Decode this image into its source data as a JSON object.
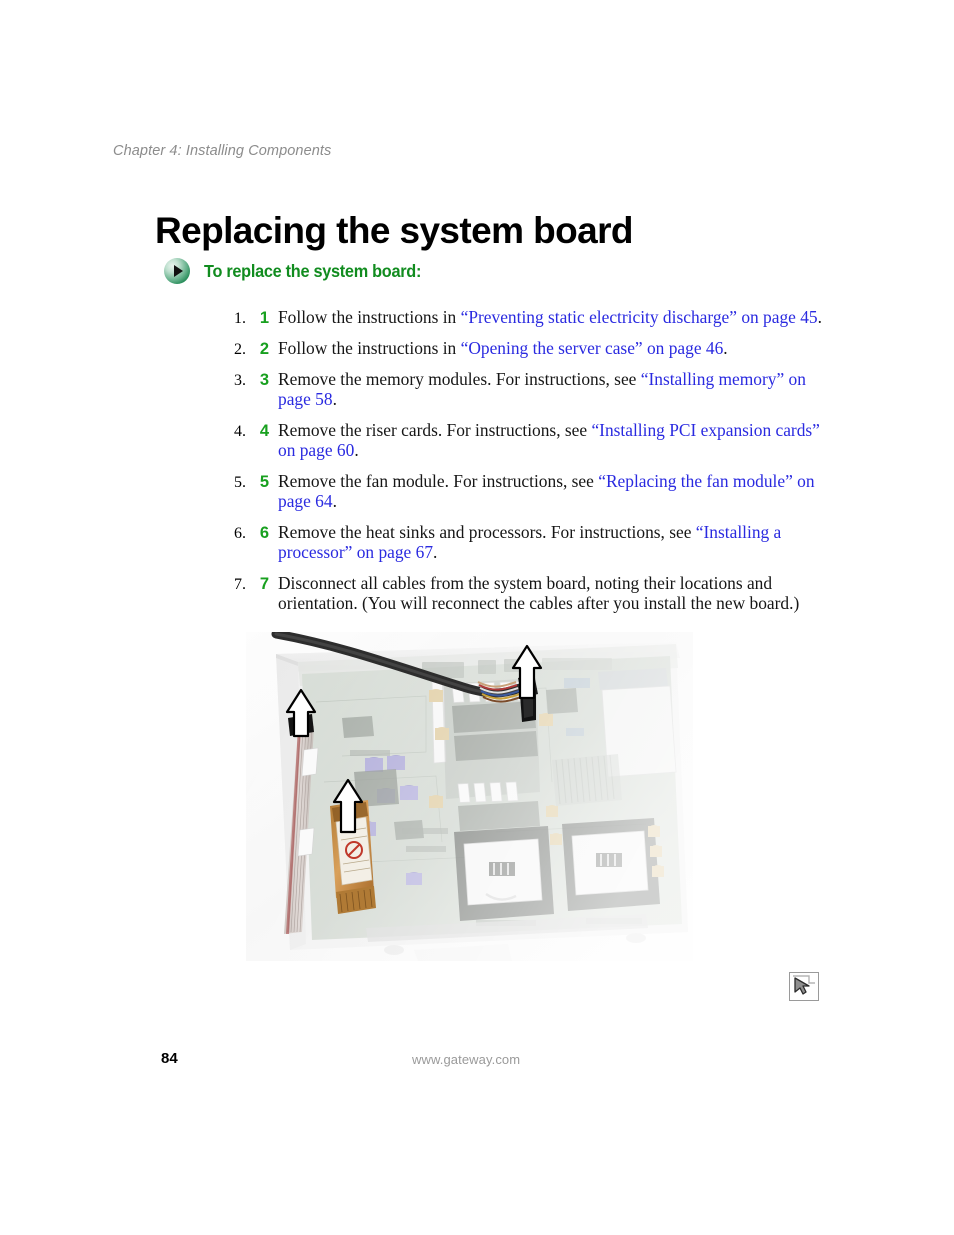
{
  "document": {
    "chapter_header": "Chapter 4: Installing Components",
    "page_title": "Replacing the system board",
    "page_number": "84",
    "footer_url": "www.gateway.com"
  },
  "procedure": {
    "bullet_icon": "play-triangle-icon",
    "heading": "To replace the system board:",
    "heading_color": "#118c1f",
    "number_color": "#18a01f",
    "xref_color": "#2a2ae0",
    "steps": [
      {
        "number": "1",
        "parts": [
          {
            "text": "Follow the instructions in ",
            "style": "normal"
          },
          {
            "text": "“Preventing static electricity discharge” on page 45",
            "style": "xref"
          },
          {
            "text": ".",
            "style": "normal"
          }
        ]
      },
      {
        "number": "2",
        "parts": [
          {
            "text": "Follow the instructions in ",
            "style": "normal"
          },
          {
            "text": "“Opening the server case” on page 46",
            "style": "xref"
          },
          {
            "text": ".",
            "style": "normal"
          }
        ]
      },
      {
        "number": "3",
        "parts": [
          {
            "text": "Remove the memory modules. For instructions, see ",
            "style": "normal"
          },
          {
            "text": "“Installing memory” on page 58",
            "style": "xref"
          },
          {
            "text": ".",
            "style": "normal"
          }
        ]
      },
      {
        "number": "4",
        "parts": [
          {
            "text": "Remove the riser cards. For instructions, see ",
            "style": "normal"
          },
          {
            "text": "“Installing PCI expansion cards” on page 60",
            "style": "xref"
          },
          {
            "text": ".",
            "style": "normal"
          }
        ]
      },
      {
        "number": "5",
        "parts": [
          {
            "text": "Remove the fan module. For instructions, see ",
            "style": "normal"
          },
          {
            "text": "“Replacing the fan module” on page 64",
            "style": "xref"
          },
          {
            "text": ".",
            "style": "normal"
          }
        ]
      },
      {
        "number": "6",
        "parts": [
          {
            "text": "Remove the heat sinks and processors. For instructions, see ",
            "style": "normal"
          },
          {
            "text": "“Installing a processor” on page 67",
            "style": "xref"
          },
          {
            "text": ".",
            "style": "normal"
          }
        ]
      },
      {
        "number": "7",
        "parts": [
          {
            "text": "Disconnect all cables from the system board, noting their locations and orientation. (You will reconnect the cables after you install the new board.)",
            "style": "normal"
          }
        ]
      }
    ]
  },
  "figure": {
    "name": "server-system-board-photo",
    "description": "Server chassis with system board, two empty CPU sockets, memory slots, ribbon cables and a wire harness; three white callout arrows point upward at cables to disconnect",
    "callout_arrows": 3
  },
  "nav_icon": {
    "name": "page-cursor-icon",
    "border_color": "#9a9a9a"
  }
}
